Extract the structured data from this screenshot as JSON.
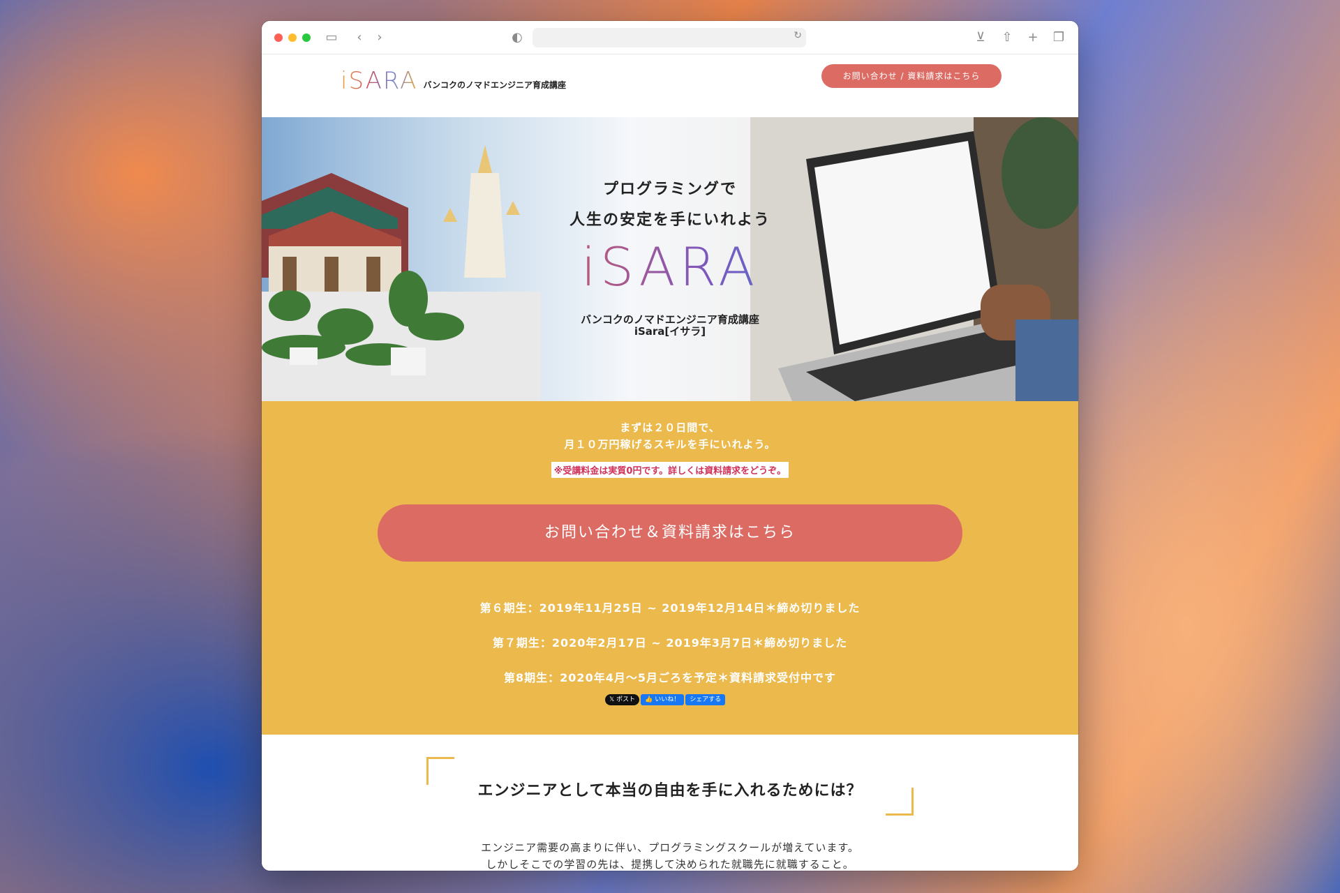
{
  "browser": {
    "url": "",
    "colors": {
      "tl_red": "#fe5f57",
      "tl_yellow": "#febc2e",
      "tl_green": "#28c840"
    }
  },
  "header": {
    "logo": "iSARA",
    "tagline": "バンコクのノマドエンジニア育成講座",
    "cta": "お問い合わせ / 資料請求はこちら"
  },
  "hero": {
    "title_line1": "プログラミングで",
    "title_line2": "人生の安定を手にいれよう",
    "logo": "iSARA",
    "sub_line1": "バンコクのノマドエンジニア育成講座",
    "sub_line2": "iSara[イサラ]"
  },
  "offer": {
    "lead_line1": "まずは２０日間で、",
    "lead_line2": "月１０万円稼げるスキルを手にいれよう。",
    "note": "※受講料金は実質0円です。詳しくは資料請求をどうぞ。",
    "cta": "お問い合わせ＆資料請求はこちら",
    "terms": [
      "第６期生：2019年11月25日 ~ 2019年12月14日＊締め切りました",
      "第７期生：2020年2月17日 ~ 2019年3月7日＊締め切りました",
      "第8期生：2020年4月〜5月ごろを予定＊資料請求受付中です"
    ],
    "share": {
      "post": "𝕏 ポスト",
      "like": "👍 いいね！",
      "share": "シェアする"
    }
  },
  "section": {
    "title": "エンジニアとして本当の自由を手に入れるためには？",
    "body_line1": "エンジニア需要の高まりに伴い、プログラミングスクールが増えています。",
    "body_line2": "しかしそこでの学習の先は、提携して決められた就職先に就職すること。"
  },
  "colors": {
    "accent": "#dc6b63",
    "yellow": "#ebb94c",
    "note_text": "#d0325a"
  }
}
